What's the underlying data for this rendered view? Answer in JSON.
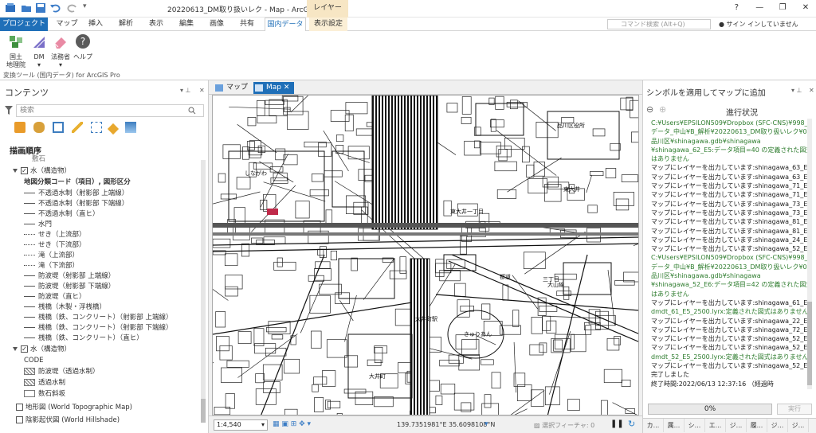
{
  "window": {
    "title": "20220613_DM取り扱いレク - Map - ArcGIS Pro",
    "contextual_tab_group": "レイヤー",
    "help": "?"
  },
  "ribbon_tabs": [
    "プロジェクト",
    "マップ",
    "挿入",
    "解析",
    "表示",
    "編集",
    "画像",
    "共有",
    "国内データ",
    "表示設定"
  ],
  "search": {
    "placeholder": "コマンド検索 (Alt+Q)"
  },
  "signin": "サイン インしていません",
  "ribbon": {
    "buttons": [
      {
        "label_1": "国土",
        "label_2": "地理院"
      },
      {
        "label_1": "DM",
        "label_2": ""
      },
      {
        "label_1": "法務省",
        "label_2": ""
      },
      {
        "label_1": "ヘルプ",
        "label_2": ""
      }
    ],
    "group_label": "変換ツール (国内データ) for ArcGIS Pro"
  },
  "contents": {
    "title": "コンテンツ",
    "search_placeholder": "検索",
    "draw_order_label": "描画順序",
    "cut_text": "敷石",
    "layer1": {
      "name": "水（構造物）",
      "field_label": "地図分類コード（項目）, 図形区分"
    },
    "layer1_items": [
      "不透過水制（射影部 上端線）",
      "不透過水制（射影部 下端線）",
      "不透過水制（直ヒ）",
      "水門",
      "せき（上流部）",
      "せき（下流部）",
      "滝（上流部）",
      "滝（下流部）",
      "防波堤（射影部 上端線）",
      "防波堤（射影部 下端線）",
      "防波堤（直ヒ）",
      "桟橋（木製・浮桟橋）",
      "桟橋（鉄、コンクリート）（射影部 上端線）",
      "桟橋（鉄、コンクリート）（射影部 下端線）",
      "桟橋（鉄、コンクリート）（直ヒ）"
    ],
    "layer2": {
      "name": "水（構造物）",
      "field_label": "CODE"
    },
    "layer2_items": [
      "防波堤（透過水制）",
      "透過水制",
      "数石斜坂"
    ],
    "basemaps": [
      "地形図 (World Topographic Map)",
      "陰影起伏図 (World Hillshade)"
    ]
  },
  "map": {
    "tabs": [
      "マップ",
      "Map"
    ],
    "scale": "1:4,540",
    "coords": "139.7351981°E 35.6098108°N",
    "selected_features": "選択フィーチャ: 0",
    "labels": [
      "東大井一丁目",
      "大井町駅",
      "大井町",
      "三丁目",
      "東大井",
      "品川区役所",
      "都道",
      "しながわ",
      "きゅりあん",
      "大山線"
    ]
  },
  "gp": {
    "title": "シンボルを適用してマップに追加",
    "header": "進行状況",
    "log": [
      {
        "t": "C:¥Users¥EPSILON509¥Dropbox (SFC-CNS)¥998_",
        "c": "g"
      },
      {
        "t": "データ_中山¥B_解析¥20220613_DM取り扱いレク¥01_",
        "c": "g"
      },
      {
        "t": "品川区¥shinagawa.gdb¥shinagawa",
        "c": "g"
      },
      {
        "t": "¥shinagawa_62_E5:データ項目=40 の定義された図式",
        "c": "g"
      },
      {
        "t": "はありません",
        "c": "g"
      },
      {
        "t": "マップにレイヤーを出力しています:shinagawa_63_E2",
        "c": "k"
      },
      {
        "t": "マップにレイヤーを出力しています:shinagawa_63_E5",
        "c": "k"
      },
      {
        "t": "マップにレイヤーを出力しています:shinagawa_71_E2",
        "c": "k"
      },
      {
        "t": "マップにレイヤーを出力しています:shinagawa_71_E7",
        "c": "k"
      },
      {
        "t": "マップにレイヤーを出力しています:shinagawa_73_E5",
        "c": "k"
      },
      {
        "t": "マップにレイヤーを出力しています:shinagawa_73_E7",
        "c": "k"
      },
      {
        "t": "マップにレイヤーを出力しています:shinagawa_81_E7",
        "c": "k"
      },
      {
        "t": "マップにレイヤーを出力しています:shinagawa_81_E5",
        "c": "k"
      },
      {
        "t": "マップにレイヤーを出力しています:shinagawa_24_E1",
        "c": "k"
      },
      {
        "t": "マップにレイヤーを出力しています:shinagawa_52_E6",
        "c": "k"
      },
      {
        "t": "C:¥Users¥EPSILON509¥Dropbox (SFC-CNS)¥998_",
        "c": "g"
      },
      {
        "t": "データ_中山¥B_解析¥20220613_DM取り扱いレク¥01_",
        "c": "g"
      },
      {
        "t": "品川区¥shinagawa.gdb¥shinagawa",
        "c": "g"
      },
      {
        "t": "¥shinagawa_52_E6:データ項目=42 の定義された図式",
        "c": "g"
      },
      {
        "t": "はありません",
        "c": "g"
      },
      {
        "t": "マップにレイヤーを出力しています:shinagawa_61_E5",
        "c": "k"
      },
      {
        "t": "dmdt_61_E5_2500.lyrx:定義された図式はありません",
        "c": "g"
      },
      {
        "t": "マップにレイヤーを出力しています:shinagawa_22_E6",
        "c": "k"
      },
      {
        "t": "マップにレイヤーを出力しています:shinagawa_72_E6",
        "c": "k"
      },
      {
        "t": "マップにレイヤーを出力しています:shinagawa_52_E2",
        "c": "k"
      },
      {
        "t": "マップにレイヤーを出力しています:shinagawa_52_E5",
        "c": "k"
      },
      {
        "t": "dmdt_52_E5_2500.lyrx:定義された図式はありません",
        "c": "g"
      },
      {
        "t": "マップにレイヤーを出力しています:shinagawa_52_E1",
        "c": "k"
      },
      {
        "t": "完了しました",
        "c": "k"
      },
      {
        "t": "終了時間:2022/06/13 12:37:16 （経過時",
        "c": "k"
      },
      {
        "t": "間:00:00:11）",
        "c": "k"
      }
    ],
    "progress": "0%",
    "run": "実行",
    "bottom_tabs": [
      "カ...",
      "属...",
      "シ...",
      "エ...",
      "ジ...",
      "履...",
      "ジ...",
      "ジ..."
    ]
  }
}
